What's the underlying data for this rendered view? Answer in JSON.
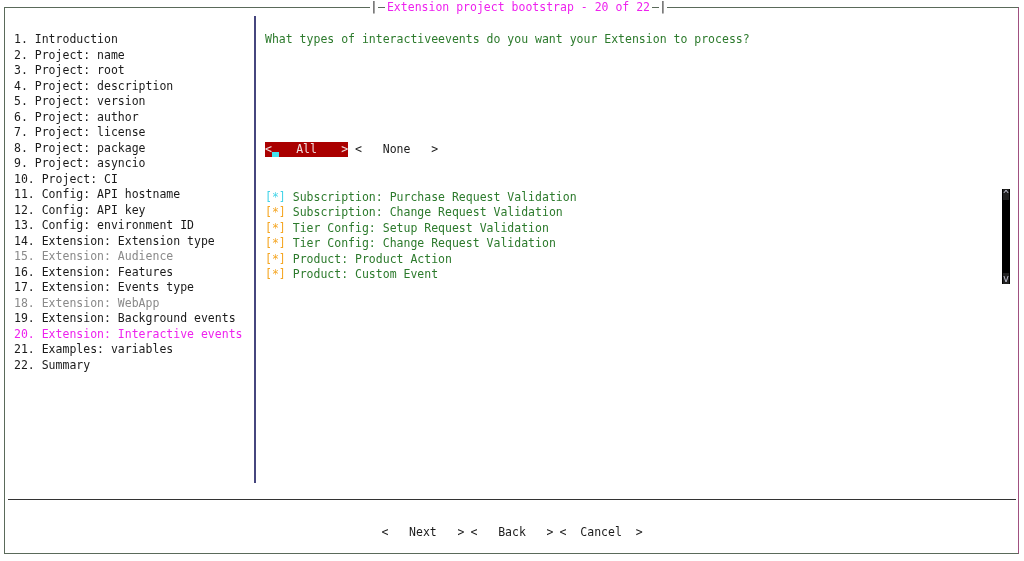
{
  "window": {
    "title": "Extension project bootstrap - 20 of 22",
    "title_left": "|",
    "title_right": "|"
  },
  "sidebar": {
    "items": [
      {
        "label": "1. Introduction",
        "selected": false,
        "disabled": false
      },
      {
        "label": "2. Project: name",
        "selected": false,
        "disabled": false
      },
      {
        "label": "3. Project: root",
        "selected": false,
        "disabled": false
      },
      {
        "label": "4. Project: description",
        "selected": false,
        "disabled": false
      },
      {
        "label": "5. Project: version",
        "selected": false,
        "disabled": false
      },
      {
        "label": "6. Project: author",
        "selected": false,
        "disabled": false
      },
      {
        "label": "7. Project: license",
        "selected": false,
        "disabled": false
      },
      {
        "label": "8. Project: package",
        "selected": false,
        "disabled": false
      },
      {
        "label": "9. Project: asyncio",
        "selected": false,
        "disabled": false
      },
      {
        "label": "10. Project: CI",
        "selected": false,
        "disabled": false
      },
      {
        "label": "11. Config: API hostname",
        "selected": false,
        "disabled": false
      },
      {
        "label": "12. Config: API key",
        "selected": false,
        "disabled": false
      },
      {
        "label": "13. Config: environment ID",
        "selected": false,
        "disabled": false
      },
      {
        "label": "14. Extension: Extension type",
        "selected": false,
        "disabled": false
      },
      {
        "label": "15. Extension: Audience",
        "selected": false,
        "disabled": true
      },
      {
        "label": "16. Extension: Features",
        "selected": false,
        "disabled": false
      },
      {
        "label": "17. Extension: Events type",
        "selected": false,
        "disabled": false
      },
      {
        "label": "18. Extension: WebApp",
        "selected": false,
        "disabled": true
      },
      {
        "label": "19. Extension: Background events",
        "selected": false,
        "disabled": false
      },
      {
        "label": "20. Extension: Interactive events",
        "selected": true,
        "disabled": false
      },
      {
        "label": "21. Examples: variables",
        "selected": false,
        "disabled": false
      },
      {
        "label": "22. Summary",
        "selected": false,
        "disabled": false
      }
    ]
  },
  "question": "What types of interactiveevents do you want your Extension to process?",
  "select_buttons": [
    {
      "open": "<",
      "label": "All",
      "close": ">",
      "selected": true
    },
    {
      "open": "<",
      "label": "None",
      "close": ">",
      "selected": false
    }
  ],
  "options": [
    {
      "box": "[*]",
      "label": "Subscription: Purchase Request Validation",
      "focused": true
    },
    {
      "box": "[*]",
      "label": "Subscription: Change Request Validation",
      "focused": false
    },
    {
      "box": "[*]",
      "label": "Tier Config: Setup Request Validation",
      "focused": false
    },
    {
      "box": "[*]",
      "label": "Tier Config: Change Request Validation",
      "focused": false
    },
    {
      "box": "[*]",
      "label": "Product: Product Action",
      "focused": false
    },
    {
      "box": "[*]",
      "label": "Product: Custom Event",
      "focused": false
    }
  ],
  "scrollbar": {
    "up": "^",
    "down": "v"
  },
  "footer_buttons": [
    {
      "open": "<",
      "label": "Next",
      "close": ">"
    },
    {
      "open": "<",
      "label": "Back",
      "close": ">"
    },
    {
      "open": "<",
      "label": "Cancel",
      "close": ">"
    }
  ]
}
